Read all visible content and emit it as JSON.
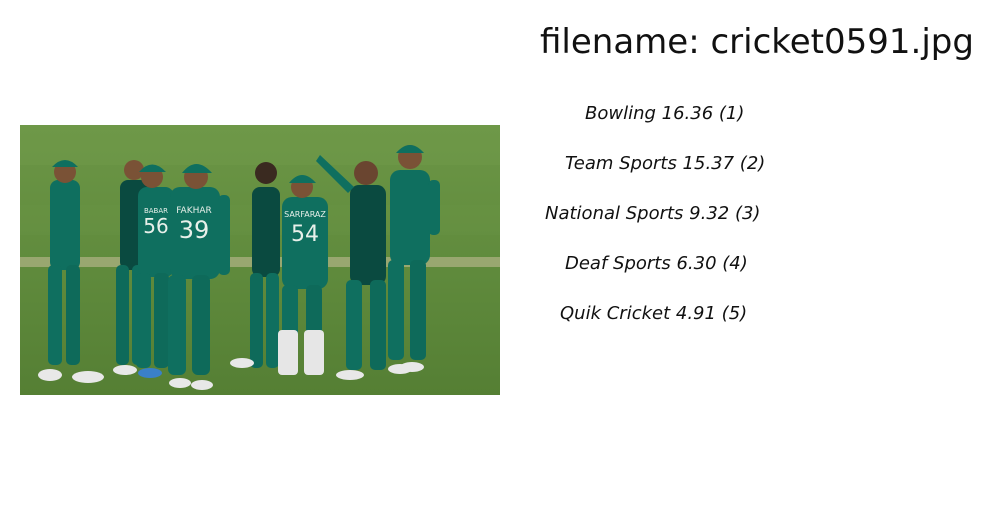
{
  "filename_label": "filename: cricket0591.jpg",
  "predictions": [
    {
      "label": "Bowling 16.36 (1)"
    },
    {
      "label": "Team Sports 15.37 (2)"
    },
    {
      "label": "National Sports  9.32 (3)"
    },
    {
      "label": "Deaf Sports  6.30 (4)"
    },
    {
      "label": "Quik Cricket  4.91 (5)"
    }
  ],
  "photo": {
    "jersey_labels": [
      {
        "name": "BABAR",
        "number": "56"
      },
      {
        "name": "FAKHAR",
        "number": "39"
      },
      {
        "name": "SARFARAZ",
        "number": "54"
      }
    ],
    "colors": {
      "grass": "#5f8a3c",
      "grass_dark": "#4b7430",
      "kit": "#0f6f5f",
      "kit_dark": "#0a4a40"
    }
  }
}
